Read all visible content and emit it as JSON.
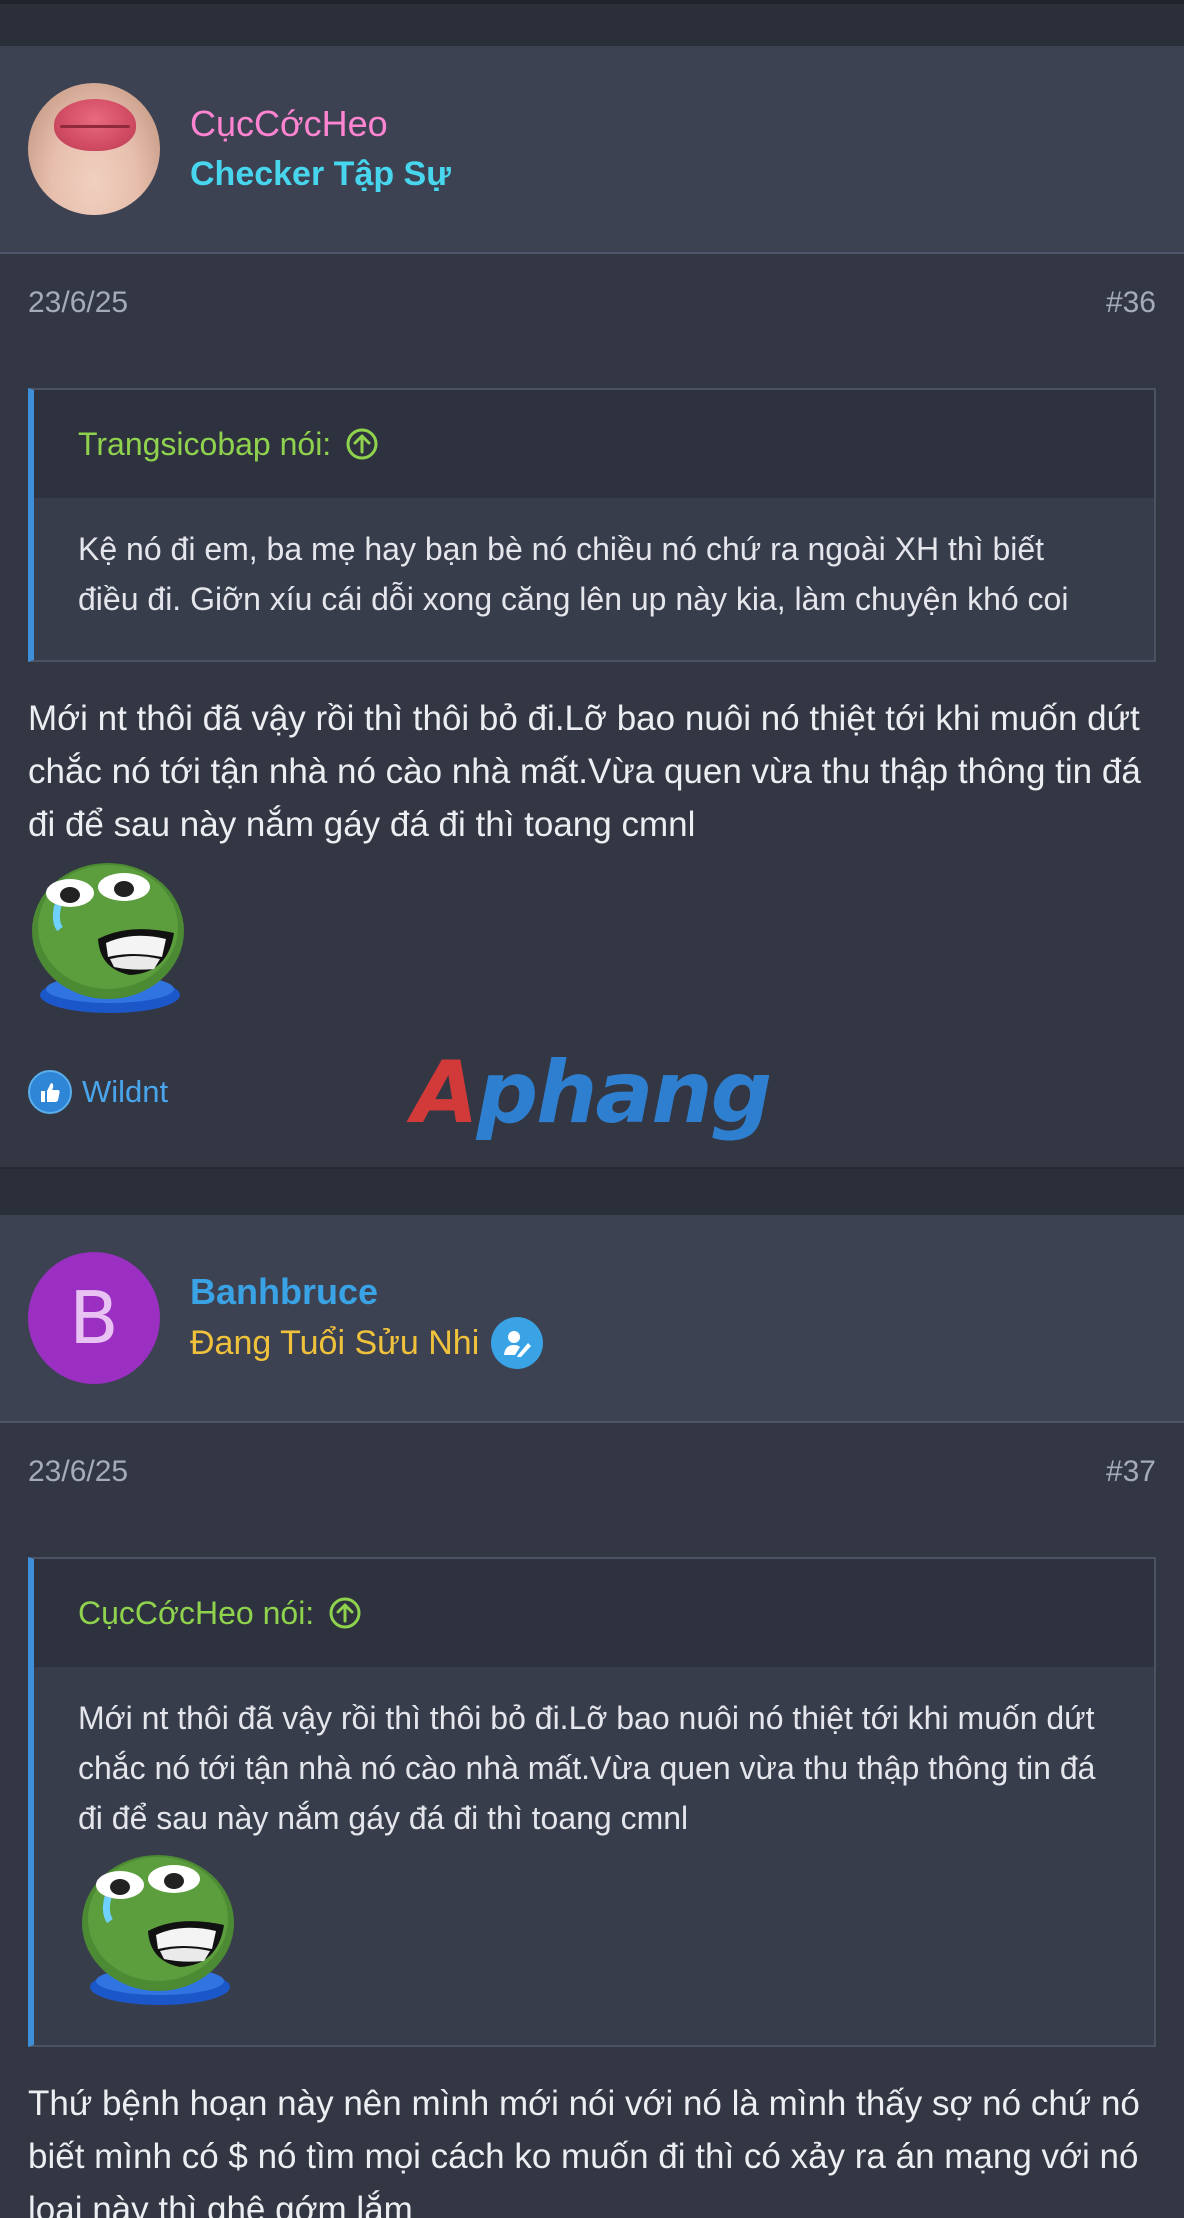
{
  "posts": [
    {
      "username": "CụcCớcHeo",
      "username_color": "#ff84d2",
      "user_title": "Checker Tập Sự",
      "user_title_color": "#47d6ee",
      "date": "23/6/25",
      "post_number": "#36",
      "quote": {
        "author": "Trangsicobap nói:",
        "text": "Kệ nó đi em, ba mẹ hay bạn bè nó chiều nó chứ ra ngoài XH thì biết điều đi. Giỡn xíu cái dỗi xong căng lên up này kia, làm chuyện khó coi"
      },
      "body": "Mới nt thôi đã vậy rồi thì thôi bỏ đi.Lỡ bao nuôi nó thiệt tới khi muốn dứt chắc nó tới tận nhà nó cào nhà mất.Vừa quen vừa thu thập thông tin đá đi để sau này nắm gáy đá đi thì toang cmnl",
      "liker": "Wildnt"
    },
    {
      "username": "Banhbruce",
      "username_color": "#3aa3e6",
      "avatar_letter": "B",
      "user_title": "Đang Tuổi Sửu Nhi",
      "user_title_color": "#f0c23c",
      "date": "23/6/25",
      "post_number": "#37",
      "quote": {
        "author": "CụcCớcHeo nói:",
        "text": "Mới nt thôi đã vậy rồi thì thôi bỏ đi.Lỡ bao nuôi nó thiệt tới khi muốn dứt chắc nó tới tận nhà nó cào nhà mất.Vừa quen vừa thu thập thông tin đá đi để sau này nắm gáy đá đi thì toang cmnl"
      },
      "body": "Thứ bệnh hoạn này nên mình mới nói với nó là mình thấy sợ nó chứ nó biết mình có $ nó tìm mọi cách ko muốn đi thì có xảy ra án mạng với nó loại này thì ghê gớm lắm"
    }
  ],
  "watermark": {
    "part1": "A",
    "part2": "phang"
  }
}
